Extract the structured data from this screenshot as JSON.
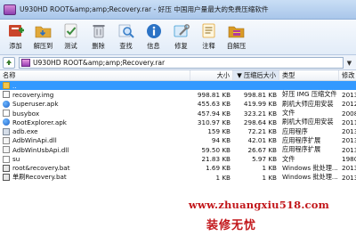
{
  "window": {
    "title": "U930HD ROOT&amp;amp;Recovery.rar - 好压 中国用户量最大的免费压缩软件"
  },
  "toolbar": [
    {
      "name": "add-button",
      "icon": "add-archive-icon",
      "label": "添加",
      "color": "#c9452b"
    },
    {
      "name": "extract-to-button",
      "icon": "extract-folder-icon",
      "label": "解压到",
      "color": "#e1a93a"
    },
    {
      "name": "test-button",
      "icon": "test-icon",
      "label": "测试",
      "color": "#3c8d3f"
    },
    {
      "name": "delete-button",
      "icon": "delete-icon",
      "label": "删除",
      "color": "#7b7f89"
    },
    {
      "name": "find-button",
      "icon": "find-icon",
      "label": "查找",
      "color": "#3a7fc8"
    },
    {
      "name": "info-button",
      "icon": "info-icon",
      "label": "信息",
      "color": "#2c73c5"
    },
    {
      "name": "repair-button",
      "icon": "repair-icon",
      "label": "修复",
      "color": "#3a9bd2"
    },
    {
      "name": "comment-button",
      "icon": "comment-icon",
      "label": "注释",
      "color": "#e0a233"
    },
    {
      "name": "self-extract-button",
      "icon": "self-extract-icon",
      "label": "自解压",
      "color": "#d99a27"
    }
  ],
  "address": {
    "path": "U930HD ROOT&amp;amp;Recovery.rar"
  },
  "columns": {
    "name": "名称",
    "size": "大小",
    "packed": "压缩后大小",
    "type": "类型",
    "modified": "修改"
  },
  "files": [
    {
      "name": "..",
      "size": "",
      "packed": "",
      "type": "",
      "modified": "",
      "icon": "folder-up-icon",
      "kind": "folder",
      "selected": true
    },
    {
      "name": "recovery.img",
      "size": "998.81 KB",
      "packed": "998.81 KB",
      "type": "好压 IMG 压缩文件",
      "modified": "2013-03-16",
      "icon": "img-file-icon",
      "kind": "img",
      "selected": false
    },
    {
      "name": "Superuser.apk",
      "size": "455.63 KB",
      "packed": "419.99 KB",
      "type": "刷机大师应用安装",
      "modified": "2012-04-06",
      "icon": "apk-icon",
      "kind": "apk",
      "selected": false
    },
    {
      "name": "busybox",
      "size": "457.94 KB",
      "packed": "323.21 KB",
      "type": "文件",
      "modified": "2008-02-29",
      "icon": "file-icon",
      "kind": "file",
      "selected": false
    },
    {
      "name": "RootExplorer.apk",
      "size": "310.97 KB",
      "packed": "298.64 KB",
      "type": "刷机大师应用安装",
      "modified": "2011-04-25",
      "icon": "apk-icon",
      "kind": "apk",
      "selected": false
    },
    {
      "name": "adb.exe",
      "size": "159 KB",
      "packed": "72.21 KB",
      "type": "应用程序",
      "modified": "2013-01-13",
      "icon": "exe-icon",
      "kind": "exe",
      "selected": false
    },
    {
      "name": "AdbWinApi.dll",
      "size": "94 KB",
      "packed": "42.01 KB",
      "type": "应用程序扩展",
      "modified": "2013-01-13",
      "icon": "dll-icon",
      "kind": "dll",
      "selected": false
    },
    {
      "name": "AdbWinUsbApi.dll",
      "size": "59.50 KB",
      "packed": "26.67 KB",
      "type": "应用程序扩展",
      "modified": "2013-01-13",
      "icon": "dll-icon",
      "kind": "dll",
      "selected": false
    },
    {
      "name": "su",
      "size": "21.83 KB",
      "packed": "5.97 KB",
      "type": "文件",
      "modified": "1980-01-06",
      "icon": "file-icon",
      "kind": "file",
      "selected": false
    },
    {
      "name": "root&recovery.bat",
      "size": "1.69 KB",
      "packed": "1 KB",
      "type": "Windows 批处理...",
      "modified": "2013-04-30",
      "icon": "bat-icon",
      "kind": "bat",
      "selected": false
    },
    {
      "name": "单刷Recovery.bat",
      "size": "1 KB",
      "packed": "1 KB",
      "type": "Windows 批处理...",
      "modified": "2013-04-30",
      "icon": "bat-icon",
      "kind": "bat",
      "selected": false
    }
  ],
  "watermark": {
    "url": "www.zhuangxiu518.com",
    "name": "装修无忧"
  }
}
